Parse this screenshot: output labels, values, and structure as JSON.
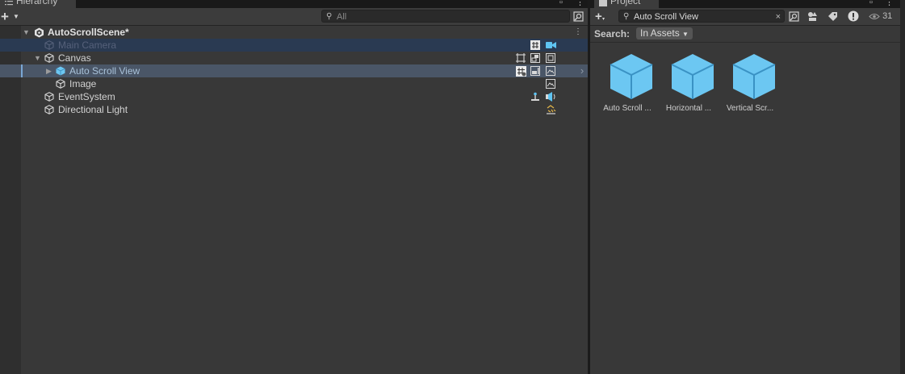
{
  "hierarchy": {
    "tab_title": "Hierarchy",
    "search_placeholder": "All",
    "scene": {
      "name": "AutoScrollScene*"
    },
    "items": [
      {
        "label": "Main Camera"
      },
      {
        "label": "Canvas"
      },
      {
        "label": "Auto Scroll View"
      },
      {
        "label": "Image"
      },
      {
        "label": "EventSystem"
      },
      {
        "label": "Directional Light"
      }
    ]
  },
  "project": {
    "tab_title": "Project",
    "search_value": "Auto Scroll View",
    "search_label": "Search:",
    "scope_label": "In Assets",
    "visibility_count": "31",
    "assets": [
      {
        "name": "Auto Scroll ..."
      },
      {
        "name": "Horizontal ..."
      },
      {
        "name": "Vertical Scr..."
      }
    ]
  },
  "colors": {
    "accent": "#7ad0ff",
    "selection": "#4a5667",
    "panel": "#383838"
  }
}
